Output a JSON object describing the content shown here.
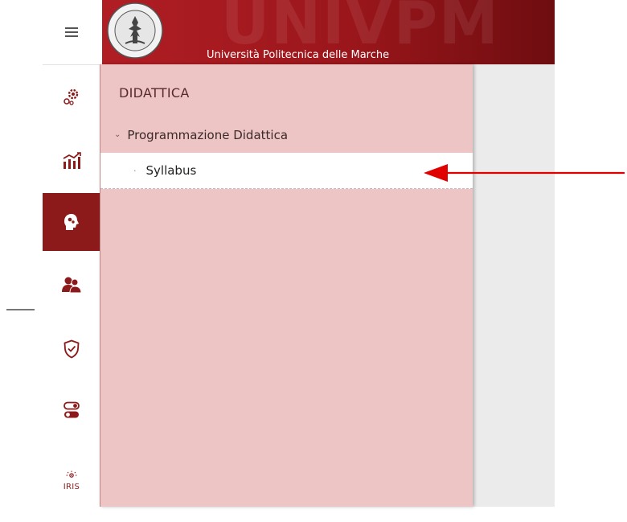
{
  "header": {
    "university_name": "Università Politecnica delle Marche",
    "background_word": "UNIVPM",
    "seal_text": "UNIVERSITÀ POLITECNICA DELLE MARCHE"
  },
  "rail": {
    "items": [
      {
        "icon": "hamburger-menu-icon"
      },
      {
        "icon": "gears-icon"
      },
      {
        "icon": "chart-growth-icon"
      },
      {
        "icon": "head-gears-icon",
        "active": true
      },
      {
        "icon": "users-icon"
      },
      {
        "icon": "shield-check-icon"
      },
      {
        "icon": "toggle-switch-icon"
      },
      {
        "icon": "iris-logo-icon",
        "text": "IRIS"
      }
    ]
  },
  "panel": {
    "title": "DIDATTICA",
    "section_label": "Programmazione Didattica",
    "section_chevron": "⌄",
    "item_bullet": "·",
    "item_label": "Syllabus"
  },
  "colors": {
    "accent": "#8c1a1a",
    "banner": "#a31a1f",
    "panel_bg": "#eec5c5",
    "arrow": "#e00000"
  }
}
